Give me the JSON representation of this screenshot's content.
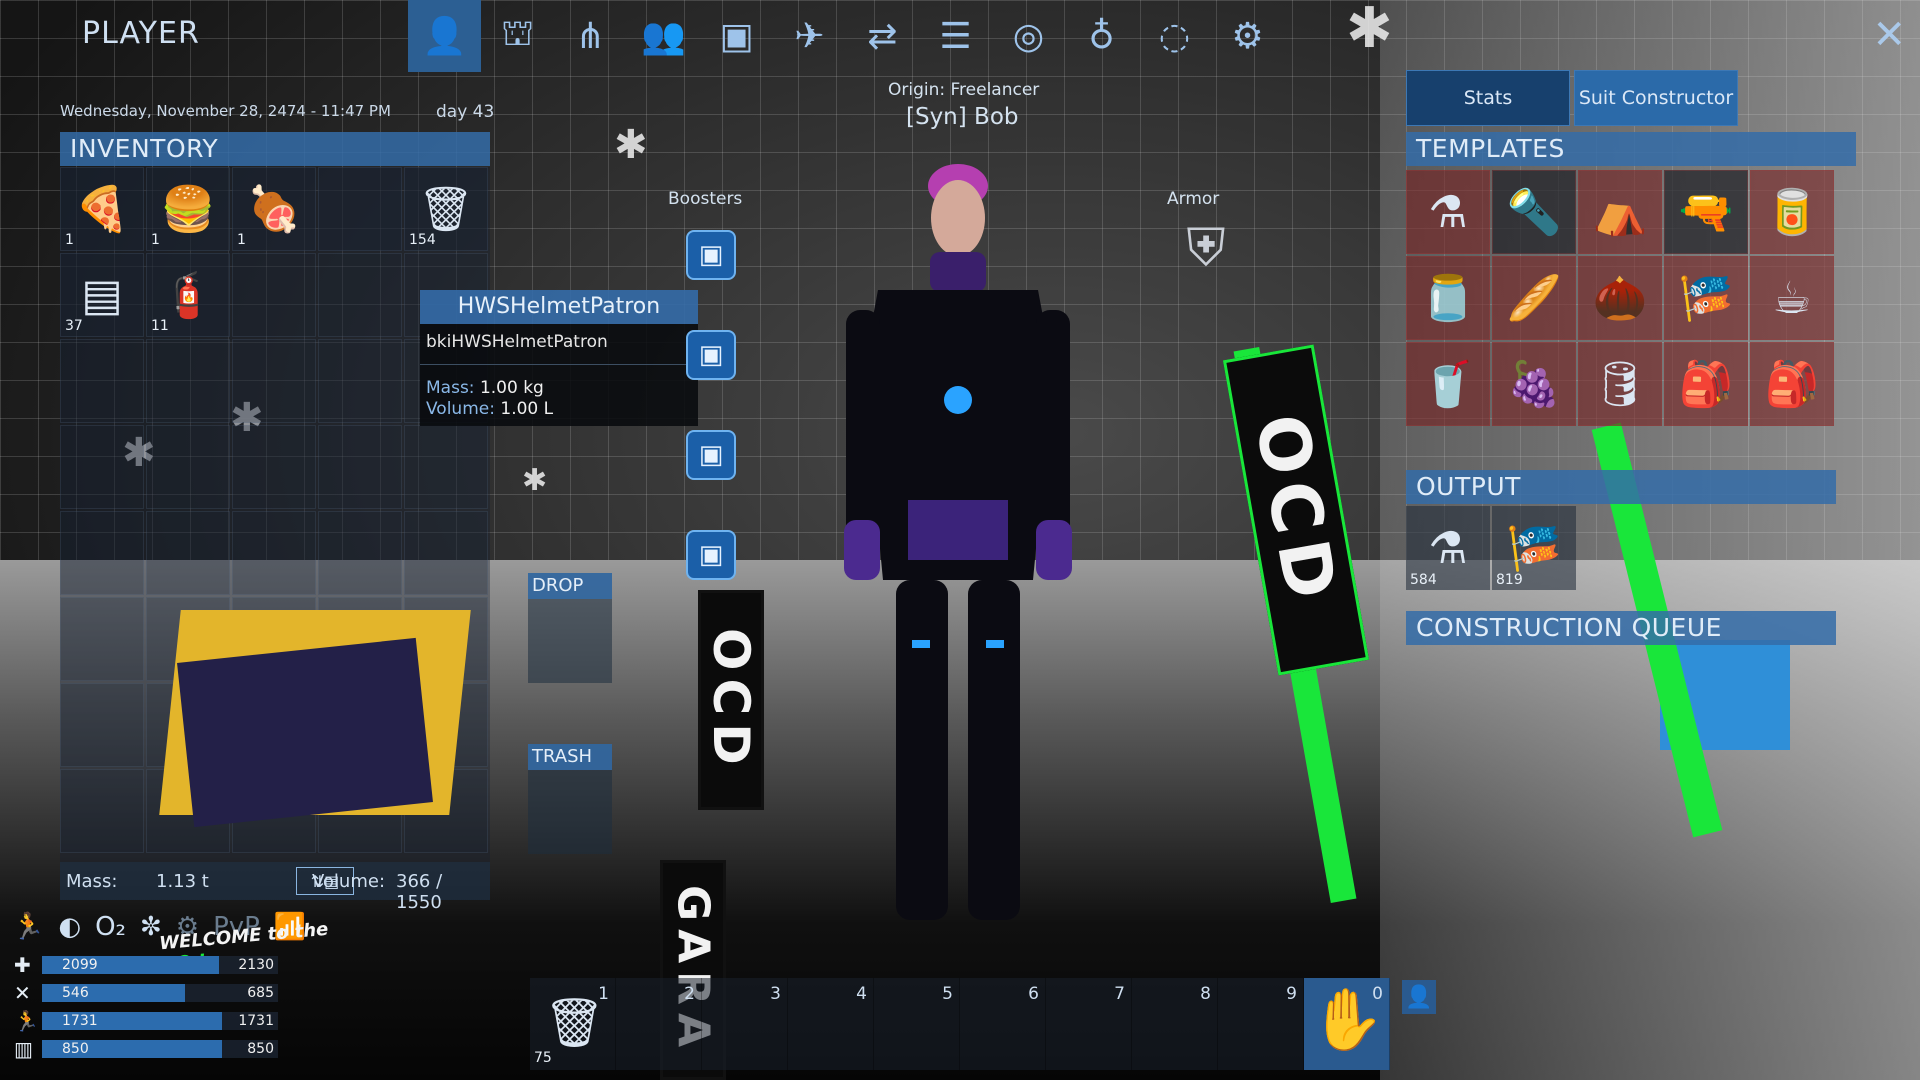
{
  "nav": {
    "title": "PLAYER",
    "tabs": [
      {
        "icon": "player-icon",
        "glyph": "👤",
        "active": true
      },
      {
        "icon": "faction-icon",
        "glyph": "⛫",
        "active": false
      },
      {
        "icon": "tech-tree-icon",
        "glyph": "⋔",
        "active": false
      },
      {
        "icon": "players-icon",
        "glyph": "👥",
        "active": false
      },
      {
        "icon": "registry-icon",
        "glyph": "▣",
        "active": false
      },
      {
        "icon": "ship-icon",
        "glyph": "✈",
        "active": false
      },
      {
        "icon": "trade-icon",
        "glyph": "⇄",
        "active": false
      },
      {
        "icon": "log-icon",
        "glyph": "☰",
        "active": false
      },
      {
        "icon": "compass-icon",
        "glyph": "◎",
        "active": false
      },
      {
        "icon": "planet-icon",
        "glyph": "♁",
        "active": false
      },
      {
        "icon": "galaxy-icon",
        "glyph": "◌",
        "active": false
      },
      {
        "icon": "settings-icon",
        "glyph": "⚙",
        "active": false
      }
    ],
    "close_glyph": "✕"
  },
  "left": {
    "datetime": "Wednesday, November 28, 2474 - 11:47 PM",
    "day": "day 43",
    "inventory_header": "INVENTORY",
    "items": [
      {
        "name": "pizza",
        "glyph": "🍕",
        "qty": "1"
      },
      {
        "name": "burger",
        "glyph": "🍔",
        "qty": "1"
      },
      {
        "name": "ribs",
        "glyph": "🍖",
        "qty": "1"
      },
      {
        "name": "empty",
        "glyph": "",
        "qty": ""
      },
      {
        "name": "trash-can",
        "glyph": "🗑",
        "qty": "154"
      },
      {
        "name": "device",
        "glyph": "▤",
        "qty": "37"
      },
      {
        "name": "gas-canister",
        "glyph": "🧯",
        "qty": "11"
      }
    ],
    "mass_label": "Mass:",
    "mass_value": "1.13 t",
    "volume_label": "Volume:",
    "volume_value": "366 / 1550",
    "sort_glyph": "⇅▤"
  },
  "tooltip": {
    "title": "HWSHelmetPatron",
    "id": "bkiHWSHelmetPatron",
    "mass_label": "Mass:",
    "mass_value": "1.00 kg",
    "volume_label": "Volume:",
    "volume_value": "1.00 L"
  },
  "drop_label": "DROP",
  "trash_label": "TRASH",
  "character": {
    "origin": "Origin: Freelancer",
    "name": "[Syn] Bob",
    "boosters_label": "Boosters",
    "armor_label": "Armor"
  },
  "right": {
    "stats_tab": "Stats",
    "suit_tab": "Suit Constructor",
    "templates_header": "TEMPLATES",
    "templates": [
      {
        "glyph": "⚗"
      },
      {
        "glyph": "🔦"
      },
      {
        "glyph": "⛺"
      },
      {
        "glyph": "🔫"
      },
      {
        "glyph": "🥫"
      },
      {
        "glyph": "🫙"
      },
      {
        "glyph": "🥖"
      },
      {
        "glyph": "🌰"
      },
      {
        "glyph": "🎏"
      },
      {
        "glyph": "☕"
      },
      {
        "glyph": "🥤"
      },
      {
        "glyph": "🍇"
      },
      {
        "glyph": "🛢"
      },
      {
        "glyph": "🎒"
      },
      {
        "glyph": "🎒"
      }
    ],
    "output_header": "OUTPUT",
    "outputs": [
      {
        "glyph": "⚗",
        "qty": "584"
      },
      {
        "glyph": "🎏",
        "qty": "819"
      }
    ],
    "queue_header": "CONSTRUCTION QUEUE"
  },
  "vitals": {
    "welcome_line1": "WELCOME to the",
    "welcome_line2": "HQ !",
    "stats": [
      {
        "name": "health",
        "glyph": "✚",
        "current": "2099",
        "max": "2130",
        "ratio": 0.985
      },
      {
        "name": "food",
        "glyph": "✕",
        "current": "546",
        "max": "685",
        "ratio": 0.797
      },
      {
        "name": "stamina",
        "glyph": "🏃",
        "current": "1731",
        "max": "1731",
        "ratio": 1.0
      },
      {
        "name": "oxygen",
        "glyph": "▥",
        "current": "850",
        "max": "850",
        "ratio": 1.0
      }
    ],
    "status_icons": [
      "🏃",
      "◐",
      "O₂",
      "✼",
      "⚙",
      "PvP",
      "📶"
    ]
  },
  "hotbar": {
    "slots": [
      {
        "num": "1",
        "glyph": "🗑",
        "qty": "75"
      },
      {
        "num": "2",
        "glyph": "",
        "qty": ""
      },
      {
        "num": "3",
        "glyph": "",
        "qty": ""
      },
      {
        "num": "4",
        "glyph": "",
        "qty": ""
      },
      {
        "num": "5",
        "glyph": "",
        "qty": ""
      },
      {
        "num": "6",
        "glyph": "",
        "qty": ""
      },
      {
        "num": "7",
        "glyph": "",
        "qty": ""
      },
      {
        "num": "8",
        "glyph": "",
        "qty": ""
      },
      {
        "num": "9",
        "glyph": "",
        "qty": ""
      },
      {
        "num": "0",
        "glyph": "✋",
        "qty": ""
      }
    ]
  },
  "colors": {
    "accent": "#2c6cae",
    "header": "#346ca8",
    "green": "#19e63a"
  }
}
